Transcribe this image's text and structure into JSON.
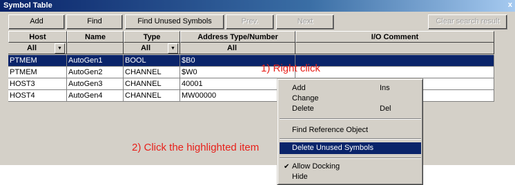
{
  "window": {
    "title": "Symbol Table",
    "close_glyph": "x"
  },
  "toolbar": {
    "add": "Add",
    "find": "Find",
    "find_unused": "Find Unused Symbols",
    "prev": "Prev.",
    "next": "Next",
    "clear": "Clear search result"
  },
  "table": {
    "headers": [
      "Host",
      "Name",
      "Type",
      "Address Type/Number",
      "I/O Comment"
    ],
    "filters": {
      "host": "All",
      "type": "All",
      "address": "All"
    },
    "rows": [
      {
        "host": "PTMEM",
        "name": "AutoGen1",
        "type": "BOOL",
        "address": "$B0",
        "comment": ""
      },
      {
        "host": "PTMEM",
        "name": "AutoGen2",
        "type": "CHANNEL",
        "address": "$W0",
        "comment": ""
      },
      {
        "host": "HOST3",
        "name": "AutoGen3",
        "type": "CHANNEL",
        "address": "40001",
        "comment": ""
      },
      {
        "host": "HOST4",
        "name": "AutoGen4",
        "type": "CHANNEL",
        "address": "MW00000",
        "comment": ""
      }
    ],
    "selected_row": 0
  },
  "annotations": {
    "step1": "1) Right click",
    "step2": "2) Click the highlighted item"
  },
  "context_menu": {
    "add": {
      "label": "Add",
      "shortcut": "Ins"
    },
    "change": {
      "label": "Change"
    },
    "delete": {
      "label": "Delete",
      "shortcut": "Del"
    },
    "find_ref": {
      "label": "Find Reference Object"
    },
    "delete_unused": {
      "label": "Delete Unused Symbols"
    },
    "allow_docking": {
      "label": "Allow Docking",
      "checked": true
    },
    "hide": {
      "label": "Hide"
    }
  },
  "colors": {
    "selection": "#0a246a",
    "annotation": "#e8201a",
    "face": "#d4d0c8"
  },
  "icons": {
    "check": "check-icon",
    "dropdown": "dropdown-arrow-icon"
  }
}
